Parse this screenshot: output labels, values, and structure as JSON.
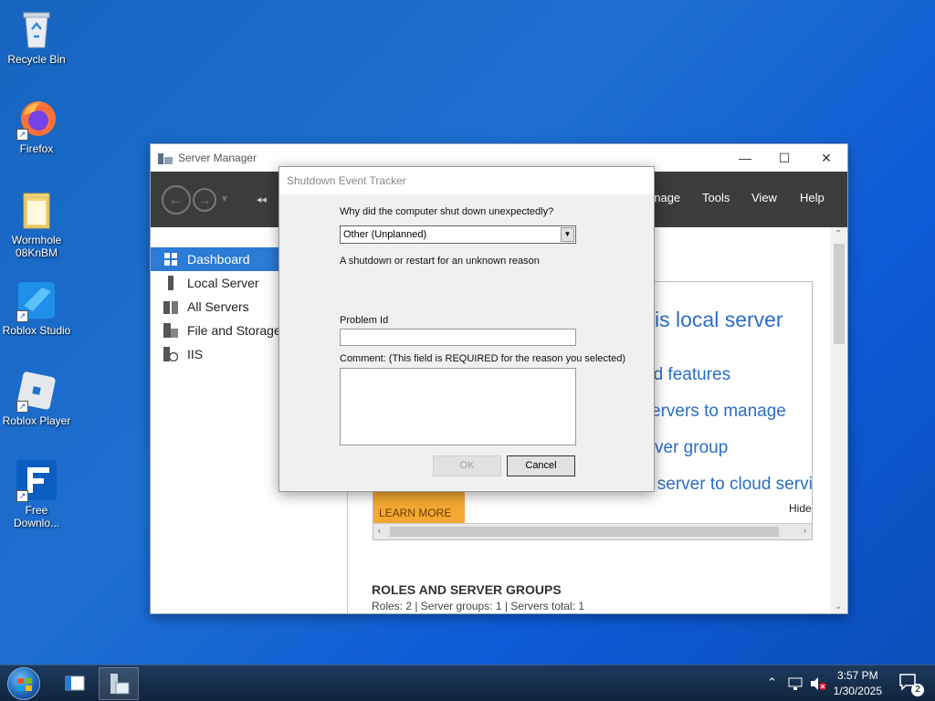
{
  "desktop": {
    "icons": [
      {
        "label_1": "Recycle Bin",
        "label_2": "",
        "icon": "recycle-bin-icon"
      },
      {
        "label_1": "Firefox",
        "label_2": "",
        "icon": "firefox-icon"
      },
      {
        "label_1": "Wormhole",
        "label_2": "08KnBM",
        "icon": "folder-icon"
      },
      {
        "label_1": "Roblox Studio",
        "label_2": "",
        "icon": "roblox-studio-icon"
      },
      {
        "label_1": "Roblox Player",
        "label_2": "",
        "icon": "roblox-player-icon"
      },
      {
        "label_1": "Free",
        "label_2": "Downlo...",
        "icon": "free-download-manager-icon"
      }
    ]
  },
  "server_manager": {
    "title": "Server Manager",
    "menu": {
      "manage": "anage",
      "tools": "Tools",
      "view": "View",
      "help": "Help"
    },
    "sidebar": [
      {
        "label": "Dashboard",
        "active": true
      },
      {
        "label": "Local Server"
      },
      {
        "label": "All Servers"
      },
      {
        "label": "File and Storage"
      },
      {
        "label": "IIS"
      }
    ],
    "welcome": {
      "heading": "is local server",
      "links": [
        "nd features",
        "ervers to manage",
        "ver group",
        "s server to cloud servic"
      ],
      "hide": "Hide",
      "learn_more": "LEARN MORE"
    },
    "roles": {
      "title": "ROLES AND SERVER GROUPS",
      "summary": "Roles: 2   |   Server groups: 1   |   Servers total: 1"
    }
  },
  "dialog": {
    "title": "Shutdown Event Tracker",
    "question": "Why did the computer shut down unexpectedly?",
    "reason_value": "Other (Unplanned)",
    "reason_description": "A shutdown or restart for an unknown reason",
    "problem_id_label": "Problem Id",
    "problem_id_value": "",
    "comment_label": "Comment: (This field is REQUIRED for the reason you selected)",
    "comment_value": "",
    "ok_label": "OK",
    "cancel_label": "Cancel"
  },
  "taskbar": {
    "time": "3:57 PM",
    "date": "1/30/2025",
    "notification_count": "2"
  },
  "colors": {
    "accent": "#2b7bd7",
    "link": "#2b6ec6",
    "learn_more": "#f4a832",
    "toolbar": "#3c3c3c"
  }
}
